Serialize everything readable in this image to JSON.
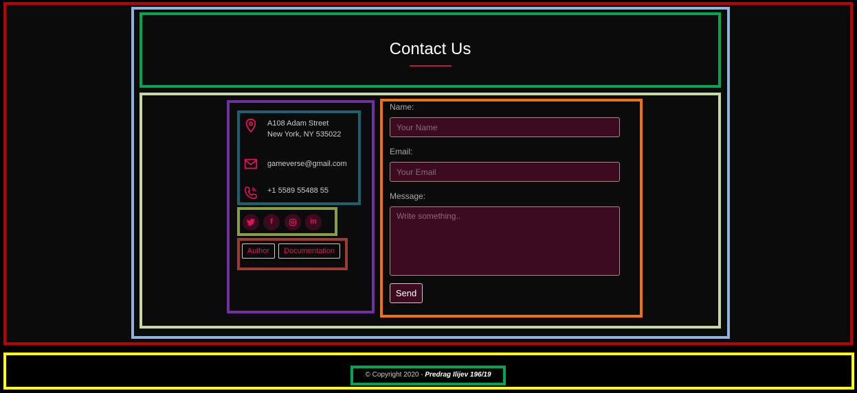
{
  "header": {
    "title": "Contact Us"
  },
  "contact": {
    "address_line1": "A108 Adam Street",
    "address_line2": "New York, NY 535022",
    "email": "gameverse@gmail.com",
    "phone": "+1 5589 55488 55"
  },
  "social": {
    "icons": [
      "twitter-icon",
      "facebook-icon",
      "instagram-icon",
      "linkedin-icon"
    ],
    "facebook_glyph": "f",
    "linkedin_glyph": "in"
  },
  "links": {
    "author": "Author",
    "documentation": "Documentation"
  },
  "form": {
    "name_label": "Name:",
    "name_placeholder": "Your Name",
    "email_label": "Email:",
    "email_placeholder": "Your Email",
    "message_label": "Message:",
    "message_placeholder": "Write something..",
    "send_label": "Send"
  },
  "footer": {
    "copyright_prefix": "© Copyright 2020 - ",
    "author": "Predrag Ilijev 196/19"
  },
  "colors": {
    "accent": "#e0145a",
    "field_bg": "#3c0b20",
    "background": "#0b0b0b"
  }
}
